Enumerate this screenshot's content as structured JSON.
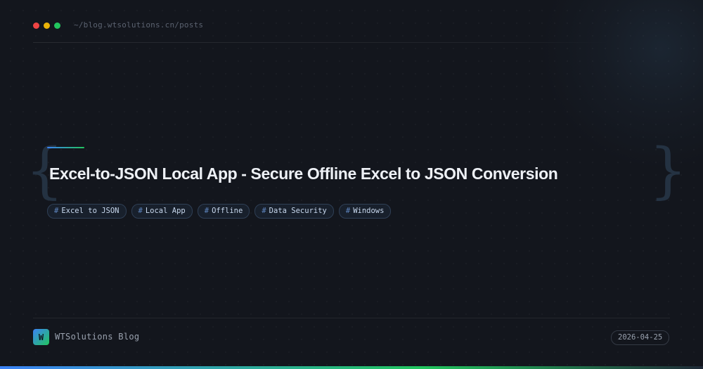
{
  "window": {
    "controls": [
      {
        "name": "close",
        "color": "#ef4444"
      },
      {
        "name": "minimize",
        "color": "#eab308"
      },
      {
        "name": "maximize",
        "color": "#22c55e"
      }
    ],
    "path": "~/blog.wtsolutions.cn/posts"
  },
  "decor": {
    "brace_left": "{",
    "brace_right": "}"
  },
  "post": {
    "title": "Excel-to-JSON Local App - Secure Offline Excel to JSON Conversion",
    "tag_prefix": "#",
    "tags": [
      "Excel to JSON",
      "Local App",
      "Offline",
      "Data Security",
      "Windows"
    ]
  },
  "footer": {
    "logo_letter": "W",
    "brand": "WTSolutions Blog",
    "date": "2026-04-25"
  },
  "colors": {
    "background": "#13161d",
    "accent_blue": "#3b82f6",
    "accent_green": "#22c55e"
  }
}
